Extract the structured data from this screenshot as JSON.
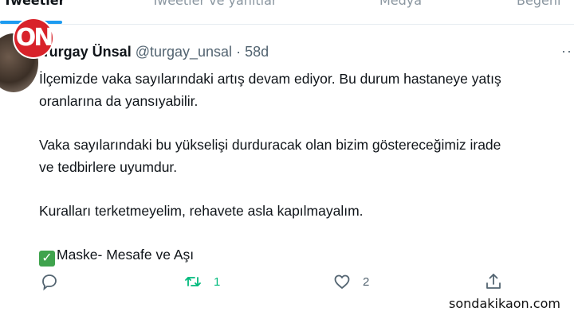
{
  "tabs": [
    "Tweetler",
    "Tweetler ve yanıtlar",
    "Medya",
    "Beğeni"
  ],
  "logo_text": "ON",
  "tweet": {
    "name": "Turgay Ünsal",
    "handle": "@turgay_unsal",
    "separator": "·",
    "time": "58d",
    "lines": [
      "İlçemizde vaka sayılarındaki artış devam ediyor. Bu durum hastaneye yatış",
      "oranlarına da yansıyabilir.",
      "Vaka sayılarındaki bu yükselişi durduracak olan bizim göstereceğimiz irade",
      "ve tedbirlere uyumdur.",
      "Kuralları terketmeyelim, rehavete asla kapılmayalım.",
      "Maske- Mesafe ve Aşı"
    ],
    "check_emoji": "✓",
    "more_icon": "more-dots-icon",
    "retweet_count": "1",
    "like_count": "2"
  },
  "icons": {
    "reply": "reply-icon",
    "retweet": "retweet-icon",
    "like": "heart-icon",
    "share": "share-icon"
  },
  "colors": {
    "accent": "#1d9bf0",
    "retweet_green": "#00ba7c",
    "logo_red": "#d8222a",
    "check_green": "#3fa34d"
  },
  "watermark": "sondakikaon.com"
}
